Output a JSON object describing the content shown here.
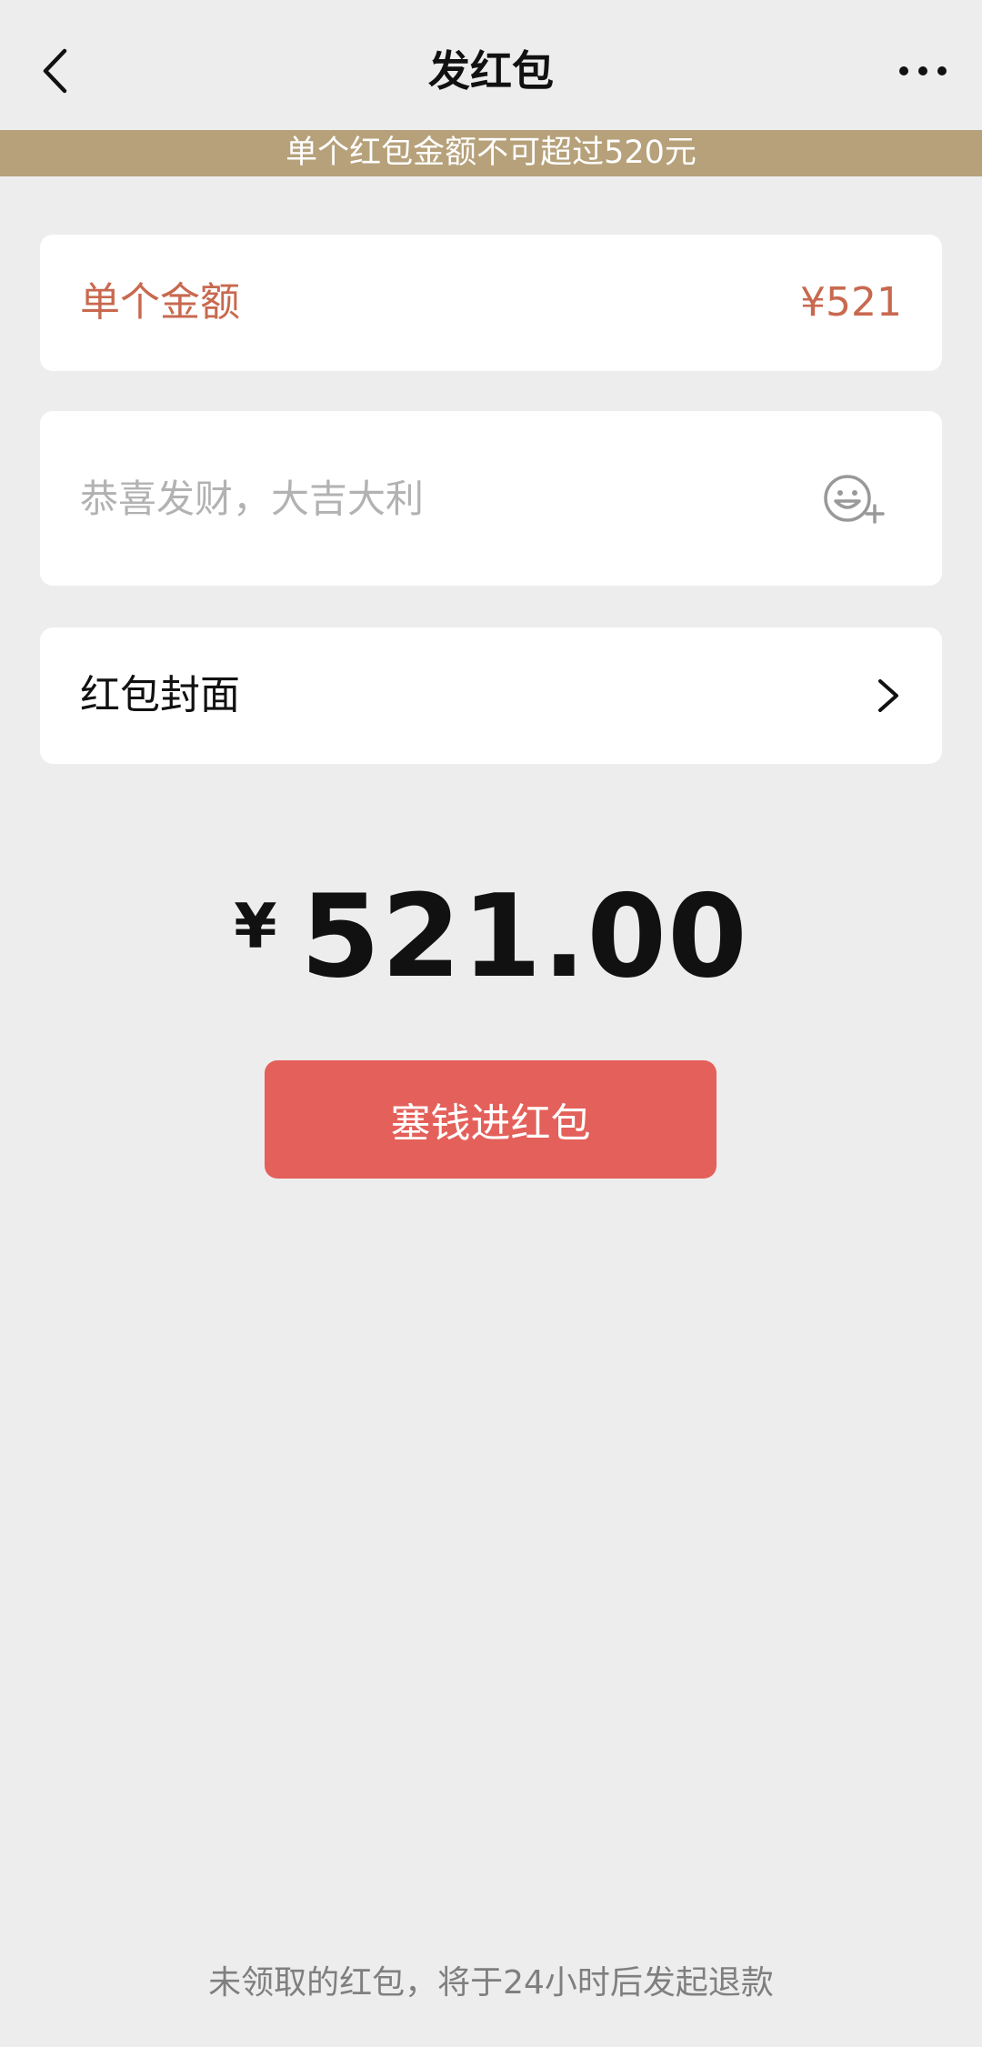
{
  "navbar": {
    "title": "发红包",
    "back_icon": "chevron-left-icon",
    "more_icon": "more-dots-icon"
  },
  "warning_banner": {
    "text": "单个红包金额不可超过520元",
    "color": "#b6a17a"
  },
  "amount_row": {
    "label": "单个金额",
    "value": "¥521",
    "color": "#c8694f"
  },
  "greeting_field": {
    "placeholder": "恭喜发财，大吉大利",
    "value": "",
    "emoji_icon": "emoji-add-icon"
  },
  "cover_row": {
    "label": "红包封面",
    "chevron_icon": "chevron-right-icon"
  },
  "total": {
    "currency": "¥",
    "value": "521.00"
  },
  "submit_button": {
    "label": "塞钱进红包",
    "color": "#e4605a"
  },
  "footer": {
    "note": "未领取的红包，将于24小时后发起退款"
  },
  "colors": {
    "background": "#ededed",
    "card": "#ffffff"
  }
}
